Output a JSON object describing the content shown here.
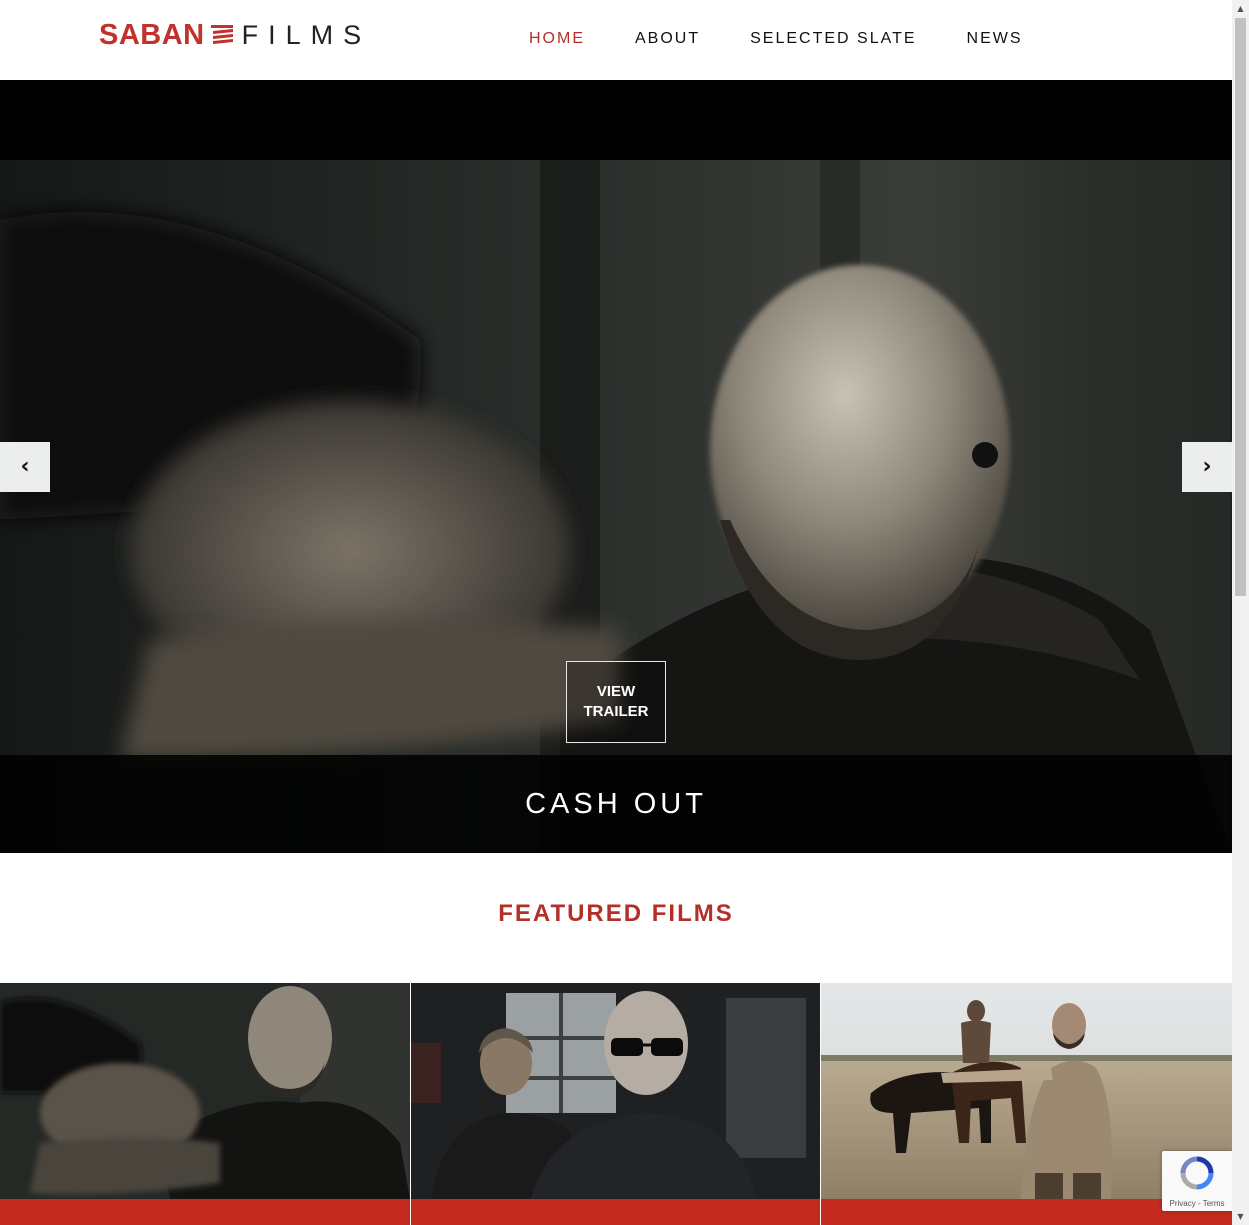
{
  "header": {
    "logo": {
      "brand": "SABAN",
      "brand_suffix": "FILMS",
      "brand_color": "#c0322b"
    },
    "nav": [
      {
        "label": "HOME",
        "active": true
      },
      {
        "label": "ABOUT",
        "active": false
      },
      {
        "label": "SELECTED SLATE",
        "active": false
      },
      {
        "label": "NEWS",
        "active": false
      }
    ]
  },
  "hero": {
    "title": "CASH OUT",
    "trailer_button": "VIEW TRAILER",
    "prev_icon": "chevron-left-icon",
    "next_icon": "chevron-right-icon"
  },
  "featured": {
    "title": "FEATURED FILMS",
    "accent_color": "#c32b1f",
    "films": [
      {
        "thumbnail": "man-aiming-gun-dark-room"
      },
      {
        "thumbnail": "two-men-indoors-sunglasses"
      },
      {
        "thumbnail": "western-desert-horses-gunman"
      }
    ]
  },
  "recaptcha": {
    "label": "Privacy - Terms",
    "icon": "recaptcha-icon"
  }
}
